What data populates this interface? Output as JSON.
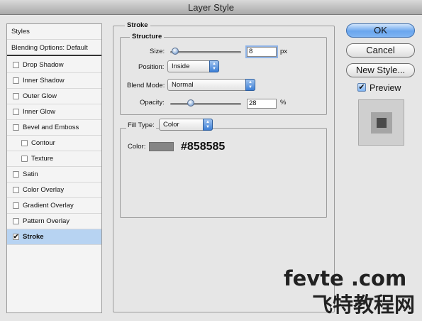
{
  "window": {
    "title": "Layer Style"
  },
  "sidebar": {
    "styles_label": "Styles",
    "blending_label": "Blending Options: Default",
    "items": [
      {
        "label": "Drop Shadow",
        "checked": false
      },
      {
        "label": "Inner Shadow",
        "checked": false
      },
      {
        "label": "Outer Glow",
        "checked": false
      },
      {
        "label": "Inner Glow",
        "checked": false
      },
      {
        "label": "Bevel and Emboss",
        "checked": false
      },
      {
        "label": "Contour",
        "checked": false
      },
      {
        "label": "Texture",
        "checked": false
      },
      {
        "label": "Satin",
        "checked": false
      },
      {
        "label": "Color Overlay",
        "checked": false
      },
      {
        "label": "Gradient Overlay",
        "checked": false
      },
      {
        "label": "Pattern Overlay",
        "checked": false
      },
      {
        "label": "Stroke",
        "checked": true,
        "selected": true
      }
    ]
  },
  "stroke": {
    "title": "Stroke",
    "structure": {
      "title": "Structure",
      "size_label": "Size:",
      "size_value": "8",
      "size_unit": "px",
      "position_label": "Position:",
      "position_value": "Inside",
      "blend_label": "Blend Mode:",
      "blend_value": "Normal",
      "opacity_label": "Opacity:",
      "opacity_value": "28",
      "opacity_unit": "%"
    },
    "fill_type_label": "Fill Type:",
    "fill_type_value": "Color",
    "color_label": "Color:",
    "color_hex_text": "#858585",
    "color_swatch": "#858585"
  },
  "buttons": {
    "ok": "OK",
    "cancel": "Cancel",
    "new_style": "New Style...",
    "preview_label": "Preview",
    "preview_checked": true
  },
  "watermark": {
    "latin": "fevte .com",
    "chinese": "飞特教程网"
  }
}
